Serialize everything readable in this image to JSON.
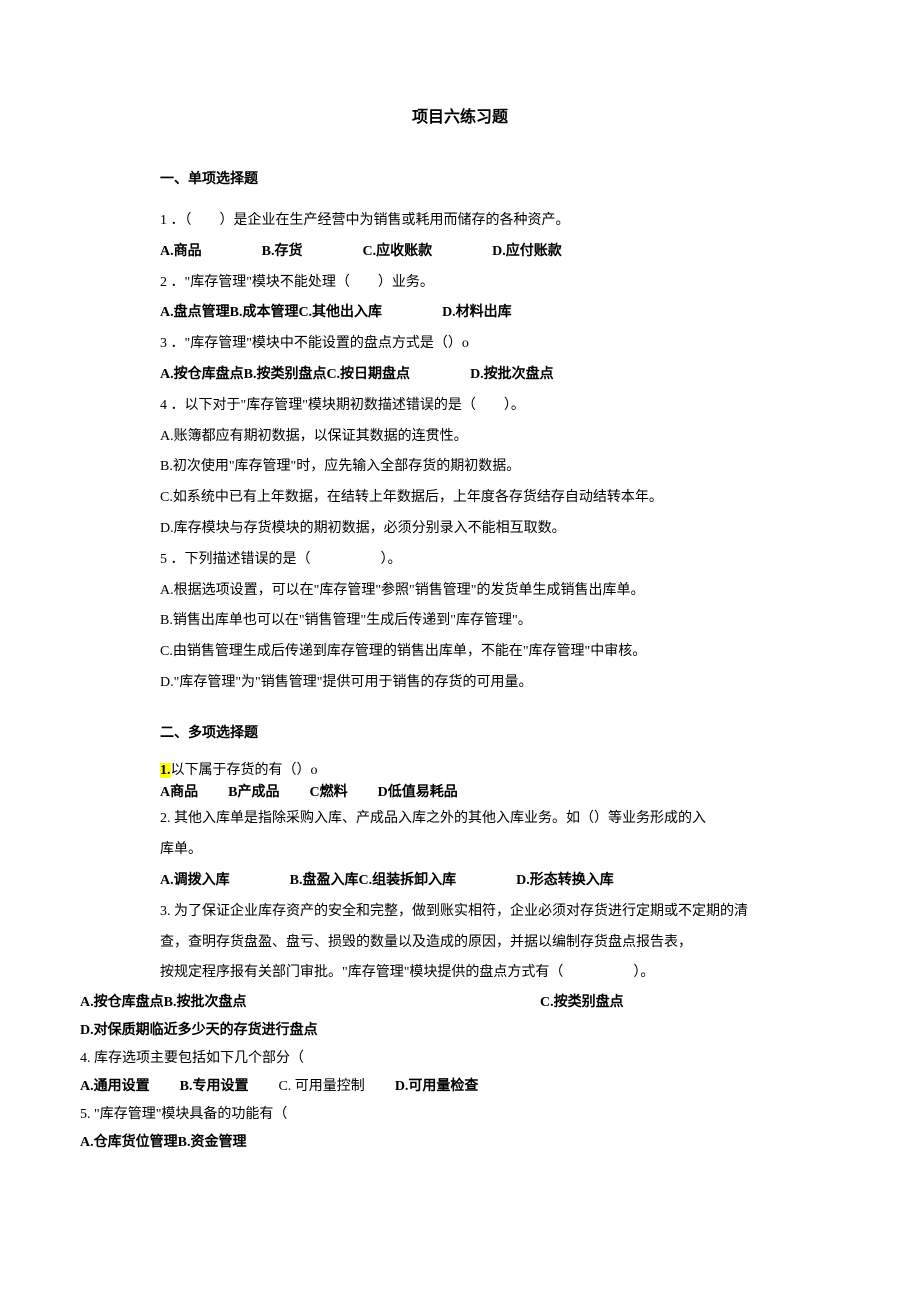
{
  "title": "项目六练习题",
  "section1": {
    "heading": "一、单项选择题",
    "q1": {
      "stem": "1 ．（　　）是企业在生产经营中为销售或耗用而储存的各种资产。",
      "a": "A.商品",
      "b": "B.存货",
      "c": "C.应收账款",
      "d": "D.应付账款"
    },
    "q2": {
      "stem": "2 ．\"库存管理\"模块不能处理（　　）业务。",
      "abc": "A.盘点管理B.成本管理C.其他出入库",
      "d": "D.材料出库"
    },
    "q3": {
      "stem": "3 ．\"库存管理\"模块中不能设置的盘点方式是（）o",
      "abc": "A.按仓库盘点B.按类别盘点C.按日期盘点",
      "d": "D.按批次盘点"
    },
    "q4": {
      "stem": "4 ．以下对于\"库存管理\"模块期初数描述错误的是（　　）。",
      "a": "A.账簿都应有期初数据，以保证其数据的连贯性。",
      "b": "B.初次使用\"库存管理\"时，应先输入全部存货的期初数据。",
      "c": "C.如系统中已有上年数据，在结转上年数据后，上年度各存货结存自动结转本年。",
      "d": "D.库存模块与存货模块的期初数据，必须分别录入不能相互取数。"
    },
    "q5": {
      "stem": "5 ．下列描述错误的是（　　　　　）。",
      "a": "A.根据选项设置，可以在\"库存管理\"参照\"销售管理\"的发货单生成销售出库单。",
      "b": "B.销售出库单也可以在\"销售管理\"生成后传递到\"库存管理\"。",
      "c": "C.由销售管理生成后传递到库存管理的销售出库单，不能在\"库存管理\"中审核。",
      "d": "D.\"库存管理\"为\"销售管理\"提供可用于销售的存货的可用量。"
    }
  },
  "section2": {
    "heading": "二、多项选择题",
    "q1": {
      "num": "1.",
      "stem": "以下属于存货的有（）o",
      "a": "A商品",
      "b": "B产成品",
      "c": "C燃料",
      "d": "D低值易耗品"
    },
    "q2": {
      "stem": "2. 其他入库单是指除采购入库、产成品入库之外的其他入库业务。如（）等业务形成的入",
      "stem2": "库单。",
      "a": "A.调拨入库",
      "bc": "B.盘盈入库C.组装拆卸入库",
      "d": "D.形态转换入库"
    },
    "q3": {
      "line1": "3. 为了保证企业库存资产的安全和完整，做到账实相符，企业必须对存货进行定期或不定期的清",
      "line2": "查，查明存货盘盈、盘亏、损毁的数量以及造成的原因，并据以编制存货盘点报告表，",
      "line3": "按规定程序报有关部门审批。\"库存管理\"模块提供的盘点方式有（　　　　　）。",
      "ab": "A.按仓库盘点B.按批次盘点",
      "c": "C.按类别盘点",
      "d": "D.对保质期临近多少天的存货进行盘点"
    },
    "q4": {
      "stem": "4. 库存选项主要包括如下几个部分（",
      "a": "A.通用设置",
      "b": "B.专用设置",
      "c": "C. 可用量控制",
      "d": "D.可用量检查"
    },
    "q5": {
      "stem": "5. \"库存管理\"模块具备的功能有（",
      "ab": "A.仓库货位管理B.资金管理"
    }
  }
}
